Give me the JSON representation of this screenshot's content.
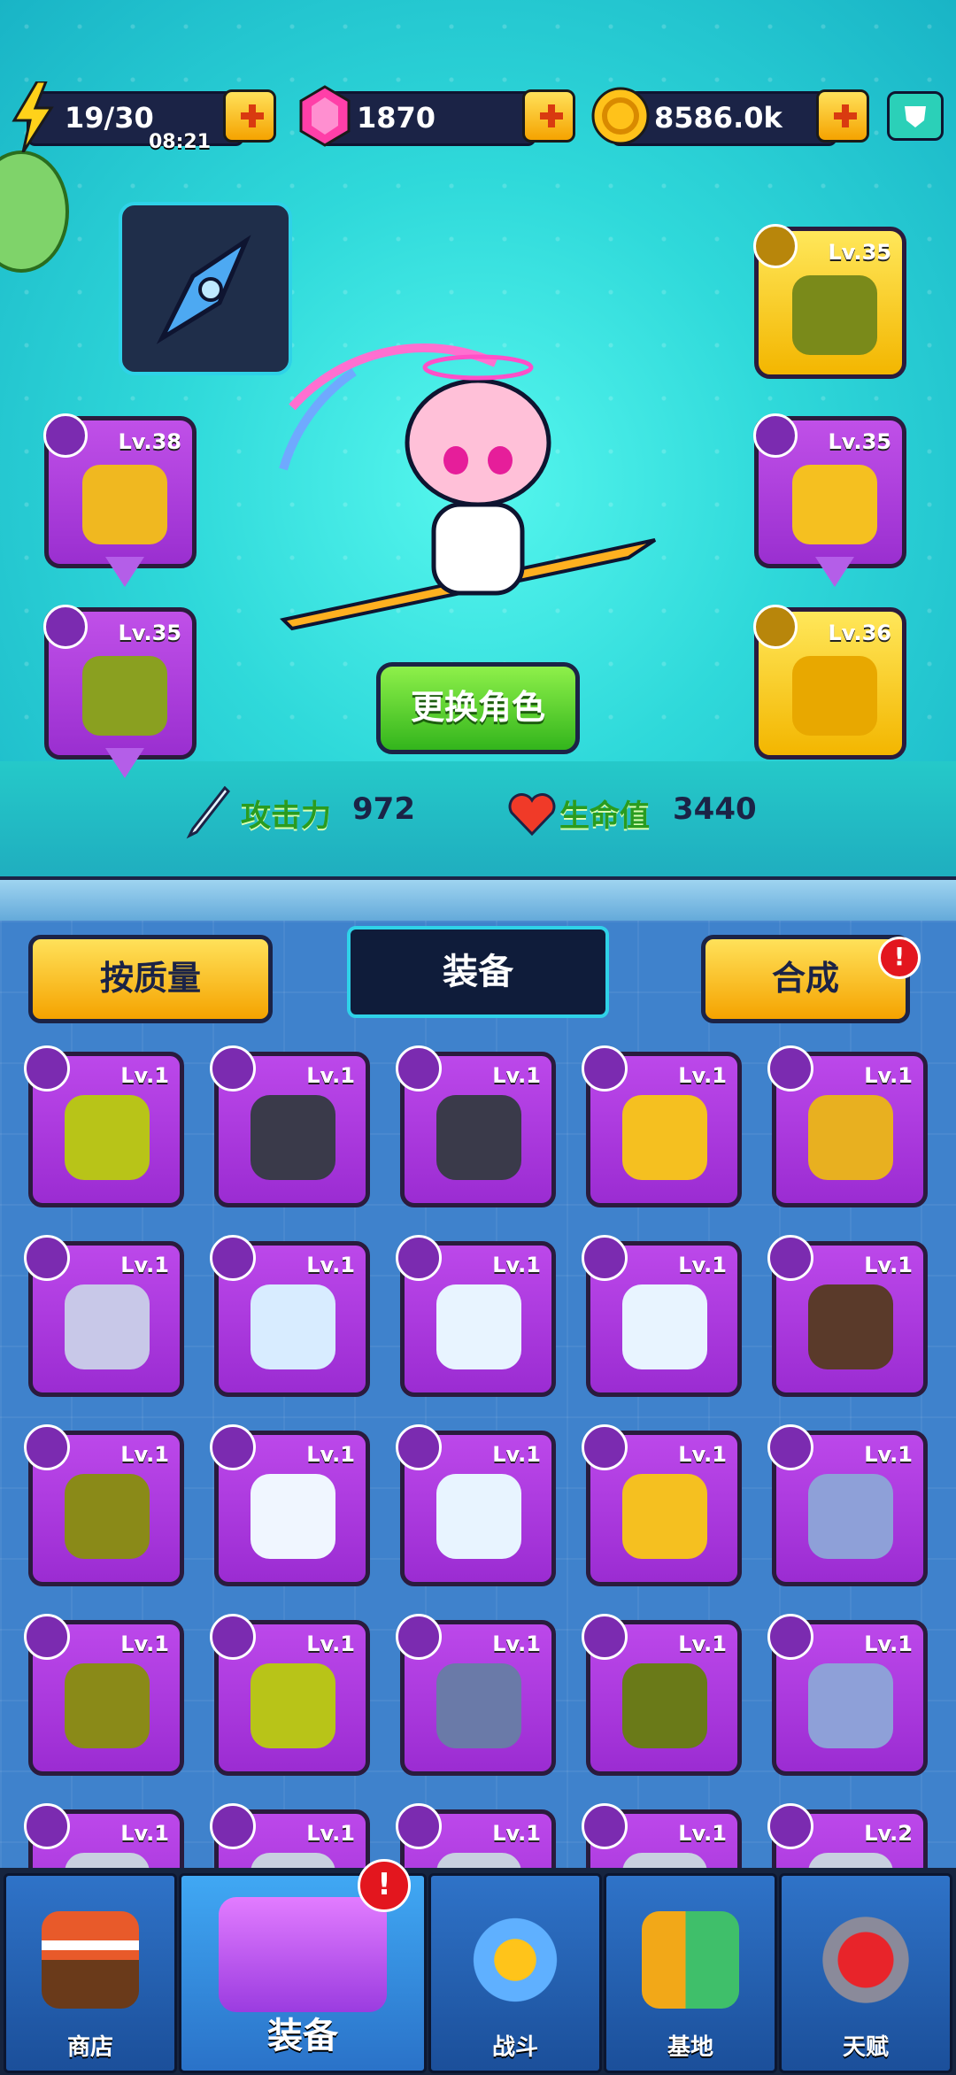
{
  "resources": {
    "energy": "19/30",
    "timer": "08:21",
    "gems": "1870",
    "coins": "8586.0k"
  },
  "character": {
    "change_button": "更换角色",
    "attack_label": "攻击力",
    "attack_value": "972",
    "hp_label": "生命值",
    "hp_value": "3440"
  },
  "equipped": {
    "necklace_lv": "Lv.38",
    "gloves_lv": "Lv.35",
    "armor_lv": "Lv.35",
    "pants_lv": "Lv.35",
    "shoes_lv": "Lv.36"
  },
  "panel": {
    "sort_button": "按质量",
    "tab_title": "装备",
    "merge_button": "合成",
    "merge_badge": "!"
  },
  "items": [
    "Lv.1",
    "Lv.1",
    "Lv.1",
    "Lv.1",
    "Lv.1",
    "Lv.1",
    "Lv.1",
    "Lv.1",
    "Lv.1",
    "Lv.1",
    "Lv.1",
    "Lv.1",
    "Lv.1",
    "Lv.1",
    "Lv.1",
    "Lv.1",
    "Lv.1",
    "Lv.1",
    "Lv.1",
    "Lv.1",
    "Lv.1",
    "Lv.1",
    "Lv.1",
    "Lv.1",
    "Lv.2"
  ],
  "nav": {
    "shop": "商店",
    "equip": "装备",
    "battle": "战斗",
    "base": "基地",
    "talent": "天赋",
    "equip_badge": "!"
  },
  "colors": {
    "purple_card": "#a63ad9",
    "gold_card": "#f7c41a",
    "scene_bg": "#2fd9da",
    "panel_bg": "#3f82cc"
  }
}
